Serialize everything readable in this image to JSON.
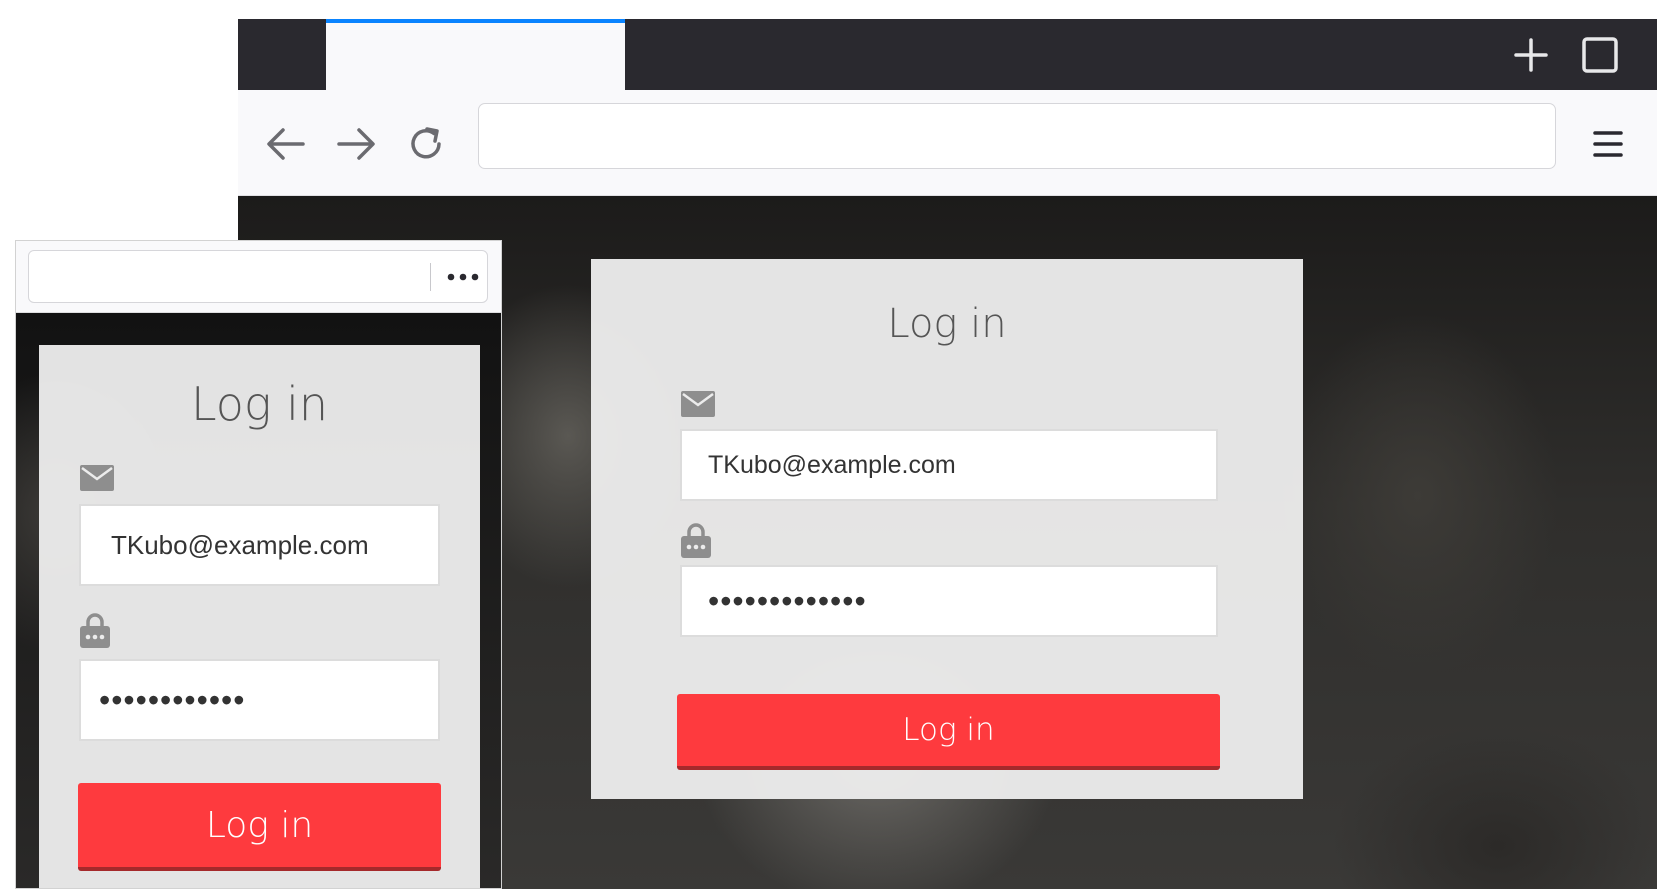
{
  "desktop": {
    "tabbar": {
      "active_tab_label": "",
      "new_tab_icon": "plus-icon",
      "maximize_icon": "square-icon",
      "accent_color": "#0a84ff"
    },
    "navbar": {
      "back_icon": "arrow-left-icon",
      "forward_icon": "arrow-right-icon",
      "reload_icon": "reload-icon",
      "url_value": "",
      "menu_icon": "hamburger-menu-icon"
    },
    "login": {
      "title": "Log in",
      "email_icon": "envelope-icon",
      "email_value": "TKubo@example.com",
      "password_icon": "lock-icon",
      "password_value": "•••••••••••••",
      "button_label": "Log in",
      "button_color": "#fe3a3e"
    }
  },
  "mobile": {
    "url_value": "",
    "more_icon": "more-dots-icon",
    "login": {
      "title": "Log in",
      "email_icon": "envelope-icon",
      "email_value": "TKubo@example.com",
      "password_icon": "lock-icon",
      "password_value": "••••••••••••",
      "button_label": "Log in",
      "button_color": "#fe3a3e"
    }
  }
}
